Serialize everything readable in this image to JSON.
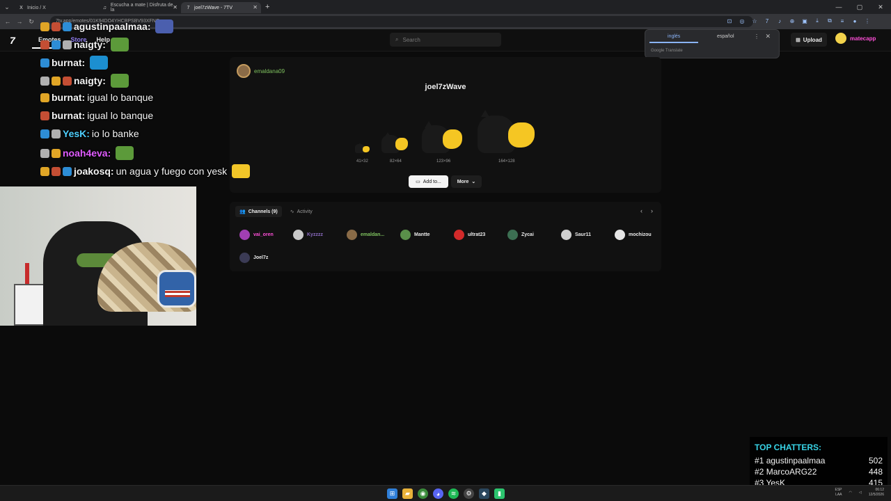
{
  "browser": {
    "tabs": [
      {
        "label": "Inicio / X",
        "icon": "x-logo-icon"
      },
      {
        "label": "Escucha a mate | Disfruta de la",
        "icon": "music-icon"
      },
      {
        "label": "joel7zWave - 7TV",
        "icon": "7tv-icon"
      }
    ],
    "url": "7tv.app/emotes/01K94DO4YHCBPSBV93XFNG"
  },
  "site": {
    "logo": "7",
    "nav": [
      "Emotes",
      "Store",
      "Help"
    ],
    "search_placeholder": "Search",
    "upload_label": "Upload",
    "username": "matecapp"
  },
  "translate_popup": {
    "lang_a": "inglés",
    "lang_b": "español",
    "provider": "Google Translate"
  },
  "emote": {
    "owner": "emaldana09",
    "name": "joel7zWave",
    "sizes": [
      "41×32",
      "82×64",
      "123×96",
      "164×128"
    ],
    "add_label": "Add to...",
    "more_label": "More"
  },
  "channels": {
    "tab_channels": "Channels (9)",
    "tab_activity": "Activity",
    "list": [
      {
        "name": "vai_oren",
        "color": "#ff4fd8",
        "av": "#a13fb2"
      },
      {
        "name": "Kyzzzz",
        "color": "#8a6ac0",
        "av": "#c9c9c9"
      },
      {
        "name": "emaldan...",
        "color": "#7fc25f",
        "av": "#8a6b47"
      },
      {
        "name": "Mantte",
        "color": "#eaeaea",
        "av": "#5a8f4a"
      },
      {
        "name": "ultrat23",
        "color": "#eaeaea",
        "av": "#d22a2a"
      },
      {
        "name": "Zycai",
        "color": "#eaeaea",
        "av": "#3c6f52"
      },
      {
        "name": "Saur11",
        "color": "#eaeaea",
        "av": "#cfcfcf"
      },
      {
        "name": "mochizou",
        "color": "#eaeaea",
        "av": "#e6e6e6"
      },
      {
        "name": "Joel7z",
        "color": "#eaeaea",
        "av": "#3b3b55"
      }
    ]
  },
  "chat": [
    {
      "user": "agustinpaalmaa:",
      "msg": "",
      "color": "#f4f4f4",
      "emote": "#4b5fae"
    },
    {
      "user": "naigty:",
      "msg": "",
      "color": "#f4f4f4",
      "emote": "#5c9a3a"
    },
    {
      "user": "burnat:",
      "msg": "",
      "color": "#f4f4f4",
      "emote": "#1c8fd0"
    },
    {
      "user": "naigty:",
      "msg": "",
      "color": "#f4f4f4",
      "emote": "#5c9a3a"
    },
    {
      "user": "burnat:",
      "msg": "igual lo banque",
      "color": "#f4f4f4",
      "emote": ""
    },
    {
      "user": "burnat:",
      "msg": "igual lo banque",
      "color": "#f4f4f4",
      "emote": ""
    },
    {
      "user": "YesK:",
      "msg": "io lo banke",
      "color": "#4fd0ff",
      "emote": ""
    },
    {
      "user": "noah4eva:",
      "msg": "",
      "color": "#e05cff",
      "emote": "#5c9a3a"
    },
    {
      "user": "joakosq:",
      "msg": "un agua y fuego con yesk",
      "color": "#f4f4f4",
      "emote": "#f2c628"
    }
  ],
  "top_chatters": {
    "title": "TOP CHATTERS:",
    "rows": [
      {
        "rank": "#1",
        "name": "agustinpaalmaa",
        "count": "502"
      },
      {
        "rank": "#2",
        "name": "MarcoARG22",
        "count": "448"
      },
      {
        "rank": "#3",
        "name": "YesK",
        "count": "415"
      }
    ]
  },
  "taskbar": {
    "lang": "ESP",
    "lang2": "LAA",
    "time": "06:12",
    "date": "12/5/2026"
  }
}
